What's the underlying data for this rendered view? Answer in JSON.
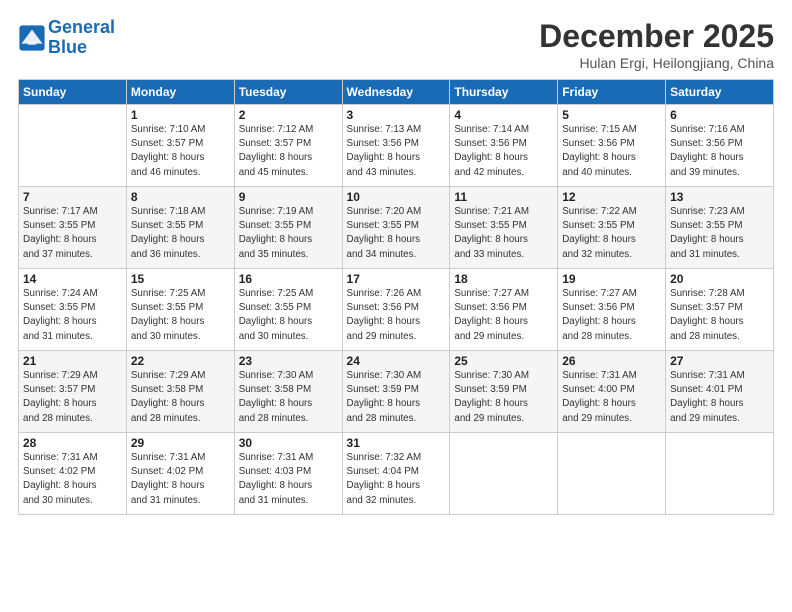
{
  "logo": {
    "line1": "General",
    "line2": "Blue"
  },
  "header": {
    "month_title": "December 2025",
    "subtitle": "Hulan Ergi, Heilongjiang, China"
  },
  "weekdays": [
    "Sunday",
    "Monday",
    "Tuesday",
    "Wednesday",
    "Thursday",
    "Friday",
    "Saturday"
  ],
  "weeks": [
    [
      {
        "day": "",
        "info": ""
      },
      {
        "day": "1",
        "info": "Sunrise: 7:10 AM\nSunset: 3:57 PM\nDaylight: 8 hours\nand 46 minutes."
      },
      {
        "day": "2",
        "info": "Sunrise: 7:12 AM\nSunset: 3:57 PM\nDaylight: 8 hours\nand 45 minutes."
      },
      {
        "day": "3",
        "info": "Sunrise: 7:13 AM\nSunset: 3:56 PM\nDaylight: 8 hours\nand 43 minutes."
      },
      {
        "day": "4",
        "info": "Sunrise: 7:14 AM\nSunset: 3:56 PM\nDaylight: 8 hours\nand 42 minutes."
      },
      {
        "day": "5",
        "info": "Sunrise: 7:15 AM\nSunset: 3:56 PM\nDaylight: 8 hours\nand 40 minutes."
      },
      {
        "day": "6",
        "info": "Sunrise: 7:16 AM\nSunset: 3:56 PM\nDaylight: 8 hours\nand 39 minutes."
      }
    ],
    [
      {
        "day": "7",
        "info": "Sunrise: 7:17 AM\nSunset: 3:55 PM\nDaylight: 8 hours\nand 37 minutes."
      },
      {
        "day": "8",
        "info": "Sunrise: 7:18 AM\nSunset: 3:55 PM\nDaylight: 8 hours\nand 36 minutes."
      },
      {
        "day": "9",
        "info": "Sunrise: 7:19 AM\nSunset: 3:55 PM\nDaylight: 8 hours\nand 35 minutes."
      },
      {
        "day": "10",
        "info": "Sunrise: 7:20 AM\nSunset: 3:55 PM\nDaylight: 8 hours\nand 34 minutes."
      },
      {
        "day": "11",
        "info": "Sunrise: 7:21 AM\nSunset: 3:55 PM\nDaylight: 8 hours\nand 33 minutes."
      },
      {
        "day": "12",
        "info": "Sunrise: 7:22 AM\nSunset: 3:55 PM\nDaylight: 8 hours\nand 32 minutes."
      },
      {
        "day": "13",
        "info": "Sunrise: 7:23 AM\nSunset: 3:55 PM\nDaylight: 8 hours\nand 31 minutes."
      }
    ],
    [
      {
        "day": "14",
        "info": "Sunrise: 7:24 AM\nSunset: 3:55 PM\nDaylight: 8 hours\nand 31 minutes."
      },
      {
        "day": "15",
        "info": "Sunrise: 7:25 AM\nSunset: 3:55 PM\nDaylight: 8 hours\nand 30 minutes."
      },
      {
        "day": "16",
        "info": "Sunrise: 7:25 AM\nSunset: 3:55 PM\nDaylight: 8 hours\nand 30 minutes."
      },
      {
        "day": "17",
        "info": "Sunrise: 7:26 AM\nSunset: 3:56 PM\nDaylight: 8 hours\nand 29 minutes."
      },
      {
        "day": "18",
        "info": "Sunrise: 7:27 AM\nSunset: 3:56 PM\nDaylight: 8 hours\nand 29 minutes."
      },
      {
        "day": "19",
        "info": "Sunrise: 7:27 AM\nSunset: 3:56 PM\nDaylight: 8 hours\nand 28 minutes."
      },
      {
        "day": "20",
        "info": "Sunrise: 7:28 AM\nSunset: 3:57 PM\nDaylight: 8 hours\nand 28 minutes."
      }
    ],
    [
      {
        "day": "21",
        "info": "Sunrise: 7:29 AM\nSunset: 3:57 PM\nDaylight: 8 hours\nand 28 minutes."
      },
      {
        "day": "22",
        "info": "Sunrise: 7:29 AM\nSunset: 3:58 PM\nDaylight: 8 hours\nand 28 minutes."
      },
      {
        "day": "23",
        "info": "Sunrise: 7:30 AM\nSunset: 3:58 PM\nDaylight: 8 hours\nand 28 minutes."
      },
      {
        "day": "24",
        "info": "Sunrise: 7:30 AM\nSunset: 3:59 PM\nDaylight: 8 hours\nand 28 minutes."
      },
      {
        "day": "25",
        "info": "Sunrise: 7:30 AM\nSunset: 3:59 PM\nDaylight: 8 hours\nand 29 minutes."
      },
      {
        "day": "26",
        "info": "Sunrise: 7:31 AM\nSunset: 4:00 PM\nDaylight: 8 hours\nand 29 minutes."
      },
      {
        "day": "27",
        "info": "Sunrise: 7:31 AM\nSunset: 4:01 PM\nDaylight: 8 hours\nand 29 minutes."
      }
    ],
    [
      {
        "day": "28",
        "info": "Sunrise: 7:31 AM\nSunset: 4:02 PM\nDaylight: 8 hours\nand 30 minutes."
      },
      {
        "day": "29",
        "info": "Sunrise: 7:31 AM\nSunset: 4:02 PM\nDaylight: 8 hours\nand 31 minutes."
      },
      {
        "day": "30",
        "info": "Sunrise: 7:31 AM\nSunset: 4:03 PM\nDaylight: 8 hours\nand 31 minutes."
      },
      {
        "day": "31",
        "info": "Sunrise: 7:32 AM\nSunset: 4:04 PM\nDaylight: 8 hours\nand 32 minutes."
      },
      {
        "day": "",
        "info": ""
      },
      {
        "day": "",
        "info": ""
      },
      {
        "day": "",
        "info": ""
      }
    ]
  ]
}
